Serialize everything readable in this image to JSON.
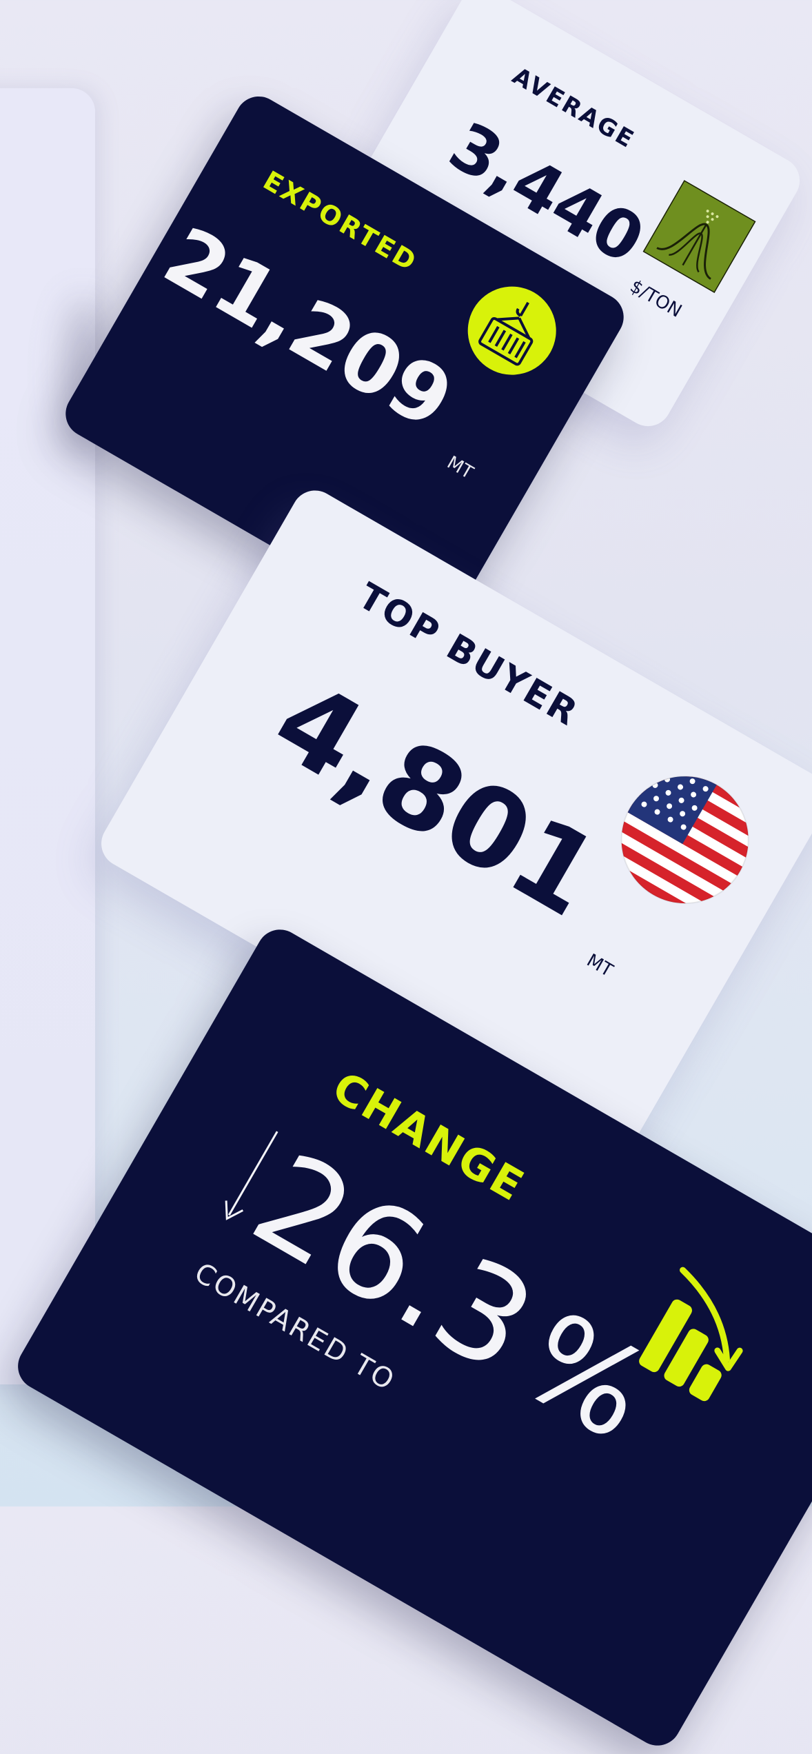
{
  "cards": {
    "average": {
      "label": "AVERAGE",
      "value": "3,440",
      "unit": "$/TON",
      "icon": "bell-curve-icon"
    },
    "exported": {
      "label": "EXPORTED",
      "value": "21,209",
      "unit": "MT",
      "icon": "container-crane-icon"
    },
    "top_buyer": {
      "label": "TOP BUYER",
      "value": "4,801",
      "unit": "MT",
      "icon": "us-flag-icon"
    },
    "change": {
      "label": "CHANGE",
      "value": "26.3",
      "unit": "%",
      "direction_icon": "arrow-down-icon",
      "note": "COMPARED TO",
      "icon": "declining-bars-icon"
    }
  },
  "colors": {
    "navy": "#0b0f3a",
    "lime": "#d8f20a",
    "light_card": "#edeff8",
    "olive": "#6f8f1f"
  }
}
